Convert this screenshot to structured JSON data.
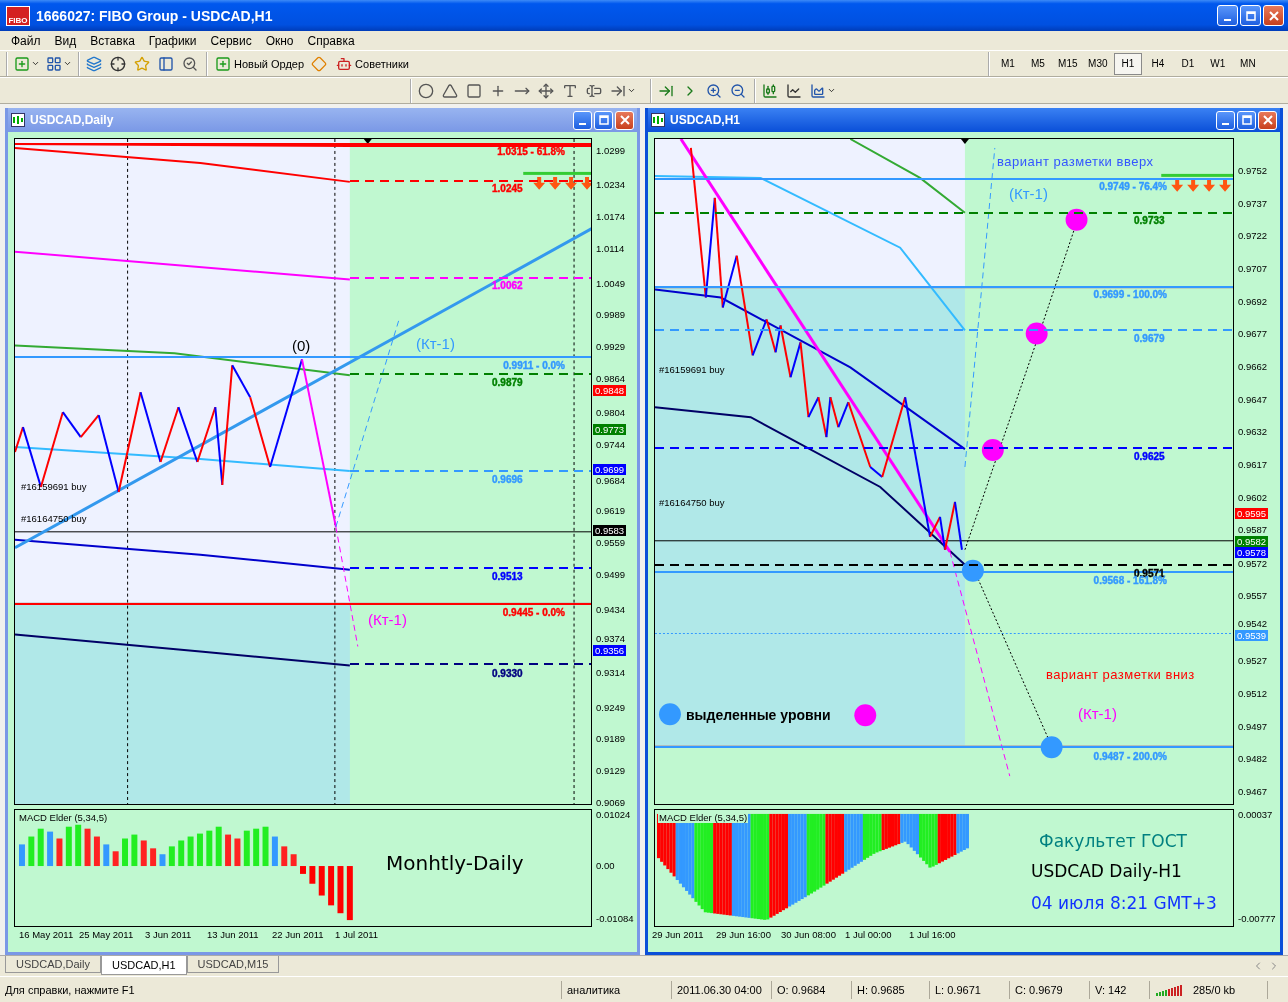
{
  "window": {
    "logo_text": "FIBO",
    "title": "1666027: FIBO Group - USDCAD,H1"
  },
  "menu": [
    "Файл",
    "Вид",
    "Вставка",
    "Графики",
    "Сервис",
    "Окно",
    "Справка"
  ],
  "toolbar": {
    "order_button": "Новый Ордер",
    "experts_button": "Советники",
    "timeframes": [
      {
        "label": "M1",
        "selected": false
      },
      {
        "label": "M5",
        "selected": false
      },
      {
        "label": "M15",
        "selected": false
      },
      {
        "label": "M30",
        "selected": false
      },
      {
        "label": "H1",
        "selected": true
      },
      {
        "label": "H4",
        "selected": false
      },
      {
        "label": "D1",
        "selected": false
      },
      {
        "label": "W1",
        "selected": false
      },
      {
        "label": "MN",
        "selected": false
      }
    ]
  },
  "charts": [
    {
      "title": "USDCAD,Daily",
      "active": false,
      "axis_ticks": [
        "1.0299",
        "1.0234",
        "1.0174",
        "1.0114",
        "1.0049",
        "0.9989",
        "0.9929",
        "0.9864",
        "0.9804",
        "0.9744",
        "0.9684",
        "0.9619",
        "0.9559",
        "0.9499",
        "0.9434",
        "0.9374",
        "0.9314",
        "0.9249",
        "0.9189",
        "0.9129",
        "0.9069"
      ],
      "badges": [
        {
          "text": "0.9848",
          "color": "#ff0000"
        },
        {
          "text": "0.9773",
          "color": "#008000"
        },
        {
          "text": "0.9699",
          "color": "#0000ff"
        },
        {
          "text": "0.9583",
          "color": "#000000"
        },
        {
          "text": "0.9356",
          "color": "#0000ff"
        }
      ],
      "levels": [
        {
          "text": "1.0315 - 61.8%",
          "kind": "fibo",
          "color": "#ff0000"
        },
        {
          "text": "1.0245",
          "kind": "line",
          "color": "#ff0000"
        },
        {
          "text": "1.0062",
          "kind": "line",
          "color": "#ff00ff"
        },
        {
          "text": "0.9911 - 0.0%",
          "kind": "fibo",
          "color": "#3399ff"
        },
        {
          "text": "0.9879",
          "kind": "line",
          "color": "#008000"
        },
        {
          "text": "0.9696",
          "kind": "line",
          "color": "#3399ff"
        },
        {
          "text": "0.9513",
          "kind": "line",
          "color": "#0000ff"
        },
        {
          "text": "0.9445 - 0.0%",
          "kind": "fibo",
          "color": "#ff0000"
        },
        {
          "text": "0.9330",
          "kind": "line",
          "color": "#000080"
        }
      ],
      "annotations": [
        {
          "text": "(0)",
          "kind": "label",
          "color": "#000000"
        },
        {
          "text": "(Кт-1)",
          "kind": "label",
          "color": "#3399ff"
        },
        {
          "text": "(Кт-1)",
          "kind": "label",
          "color": "#ff00ff"
        }
      ],
      "orders": [
        "#16159691 buy",
        "#16164750 buy"
      ],
      "macd": {
        "title": "MACD Elder (5,34,5)",
        "ticks": [
          "0.01024",
          "0.00",
          "-0.01084"
        ],
        "overlays": [
          {
            "text": "Monhtly-Daily",
            "color": "#000000"
          }
        ]
      },
      "x_labels": [
        "16 May 2011",
        "25 May 2011",
        "3 Jun 2011",
        "13 Jun 2011",
        "22 Jun 2011",
        "1 Jul 2011"
      ]
    },
    {
      "title": "USDCAD,H1",
      "active": true,
      "axis_ticks": [
        "0.9752",
        "0.9737",
        "0.9722",
        "0.9707",
        "0.9692",
        "0.9677",
        "0.9662",
        "0.9647",
        "0.9632",
        "0.9617",
        "0.9602",
        "0.9587",
        "0.9572",
        "0.9557",
        "0.9542",
        "0.9527",
        "0.9512",
        "0.9497",
        "0.9482",
        "0.9467"
      ],
      "badges": [
        {
          "text": "0.9595",
          "color": "#ff0000"
        },
        {
          "text": "0.9582",
          "color": "#008000"
        },
        {
          "text": "0.9578",
          "color": "#0000ff"
        },
        {
          "text": "0.9539",
          "color": "#3399ff"
        }
      ],
      "levels": [
        {
          "text": "0.9749 - 76.4%",
          "kind": "fibo",
          "color": "#3399ff"
        },
        {
          "text": "0.9733",
          "kind": "line",
          "color": "#008000"
        },
        {
          "text": "0.9699 - 100.0%",
          "kind": "fibo",
          "color": "#3399ff"
        },
        {
          "text": "0.9679",
          "kind": "line",
          "color": "#3399ff"
        },
        {
          "text": "0.9625",
          "kind": "line",
          "color": "#0000ff"
        },
        {
          "text": "0.9571",
          "kind": "line",
          "color": "#000000"
        },
        {
          "text": "0.9568 - 161.8%",
          "kind": "fibo",
          "color": "#3399ff"
        },
        {
          "text": "0.9487 - 200.0%",
          "kind": "fibo",
          "color": "#3399ff"
        }
      ],
      "annotations": [
        {
          "text": "вариант разметки вверх",
          "kind": "note",
          "color": "#3355ff"
        },
        {
          "text": "(Кт-1)",
          "kind": "label",
          "color": "#3399ff"
        },
        {
          "text": "вариант разметки вниз",
          "kind": "note",
          "color": "#ff0000"
        },
        {
          "text": "выделенные уровни",
          "kind": "legend",
          "color": "#000000"
        },
        {
          "text": "(Кт-1)",
          "kind": "label",
          "color": "#ff00ff"
        }
      ],
      "orders": [
        "#16159691 buy",
        "#16164750 buy"
      ],
      "macd": {
        "title": "MACD Elder (5,34,5)",
        "ticks": [
          "0.00037",
          "-0.00777"
        ],
        "overlays": [
          {
            "text": "Факультет ГОСТ",
            "color": "#008080"
          },
          {
            "text": "USDCAD Daily-H1",
            "color": "#000000"
          },
          {
            "text": "04 июля 8:21 GMT+3",
            "color": "#1133ff"
          }
        ]
      },
      "x_labels": [
        "29 Jun 2011",
        "29 Jun 16:00",
        "30 Jun 08:00",
        "1 Jul 00:00",
        "1 Jul 16:00"
      ]
    }
  ],
  "tabs": [
    {
      "label": "USDCAD,Daily",
      "selected": false
    },
    {
      "label": "USDCAD,H1",
      "selected": true
    },
    {
      "label": "USDCAD,M15",
      "selected": false
    }
  ],
  "status_bar": {
    "help": "Для справки, нажмите F1",
    "profile": "аналитика",
    "time": "2011.06.30 04:00",
    "open": "O: 0.9684",
    "high": "H: 0.9685",
    "low": "L: 0.9671",
    "close": "C: 0.9679",
    "volume": "V: 142",
    "traffic": "285/0 kb"
  }
}
